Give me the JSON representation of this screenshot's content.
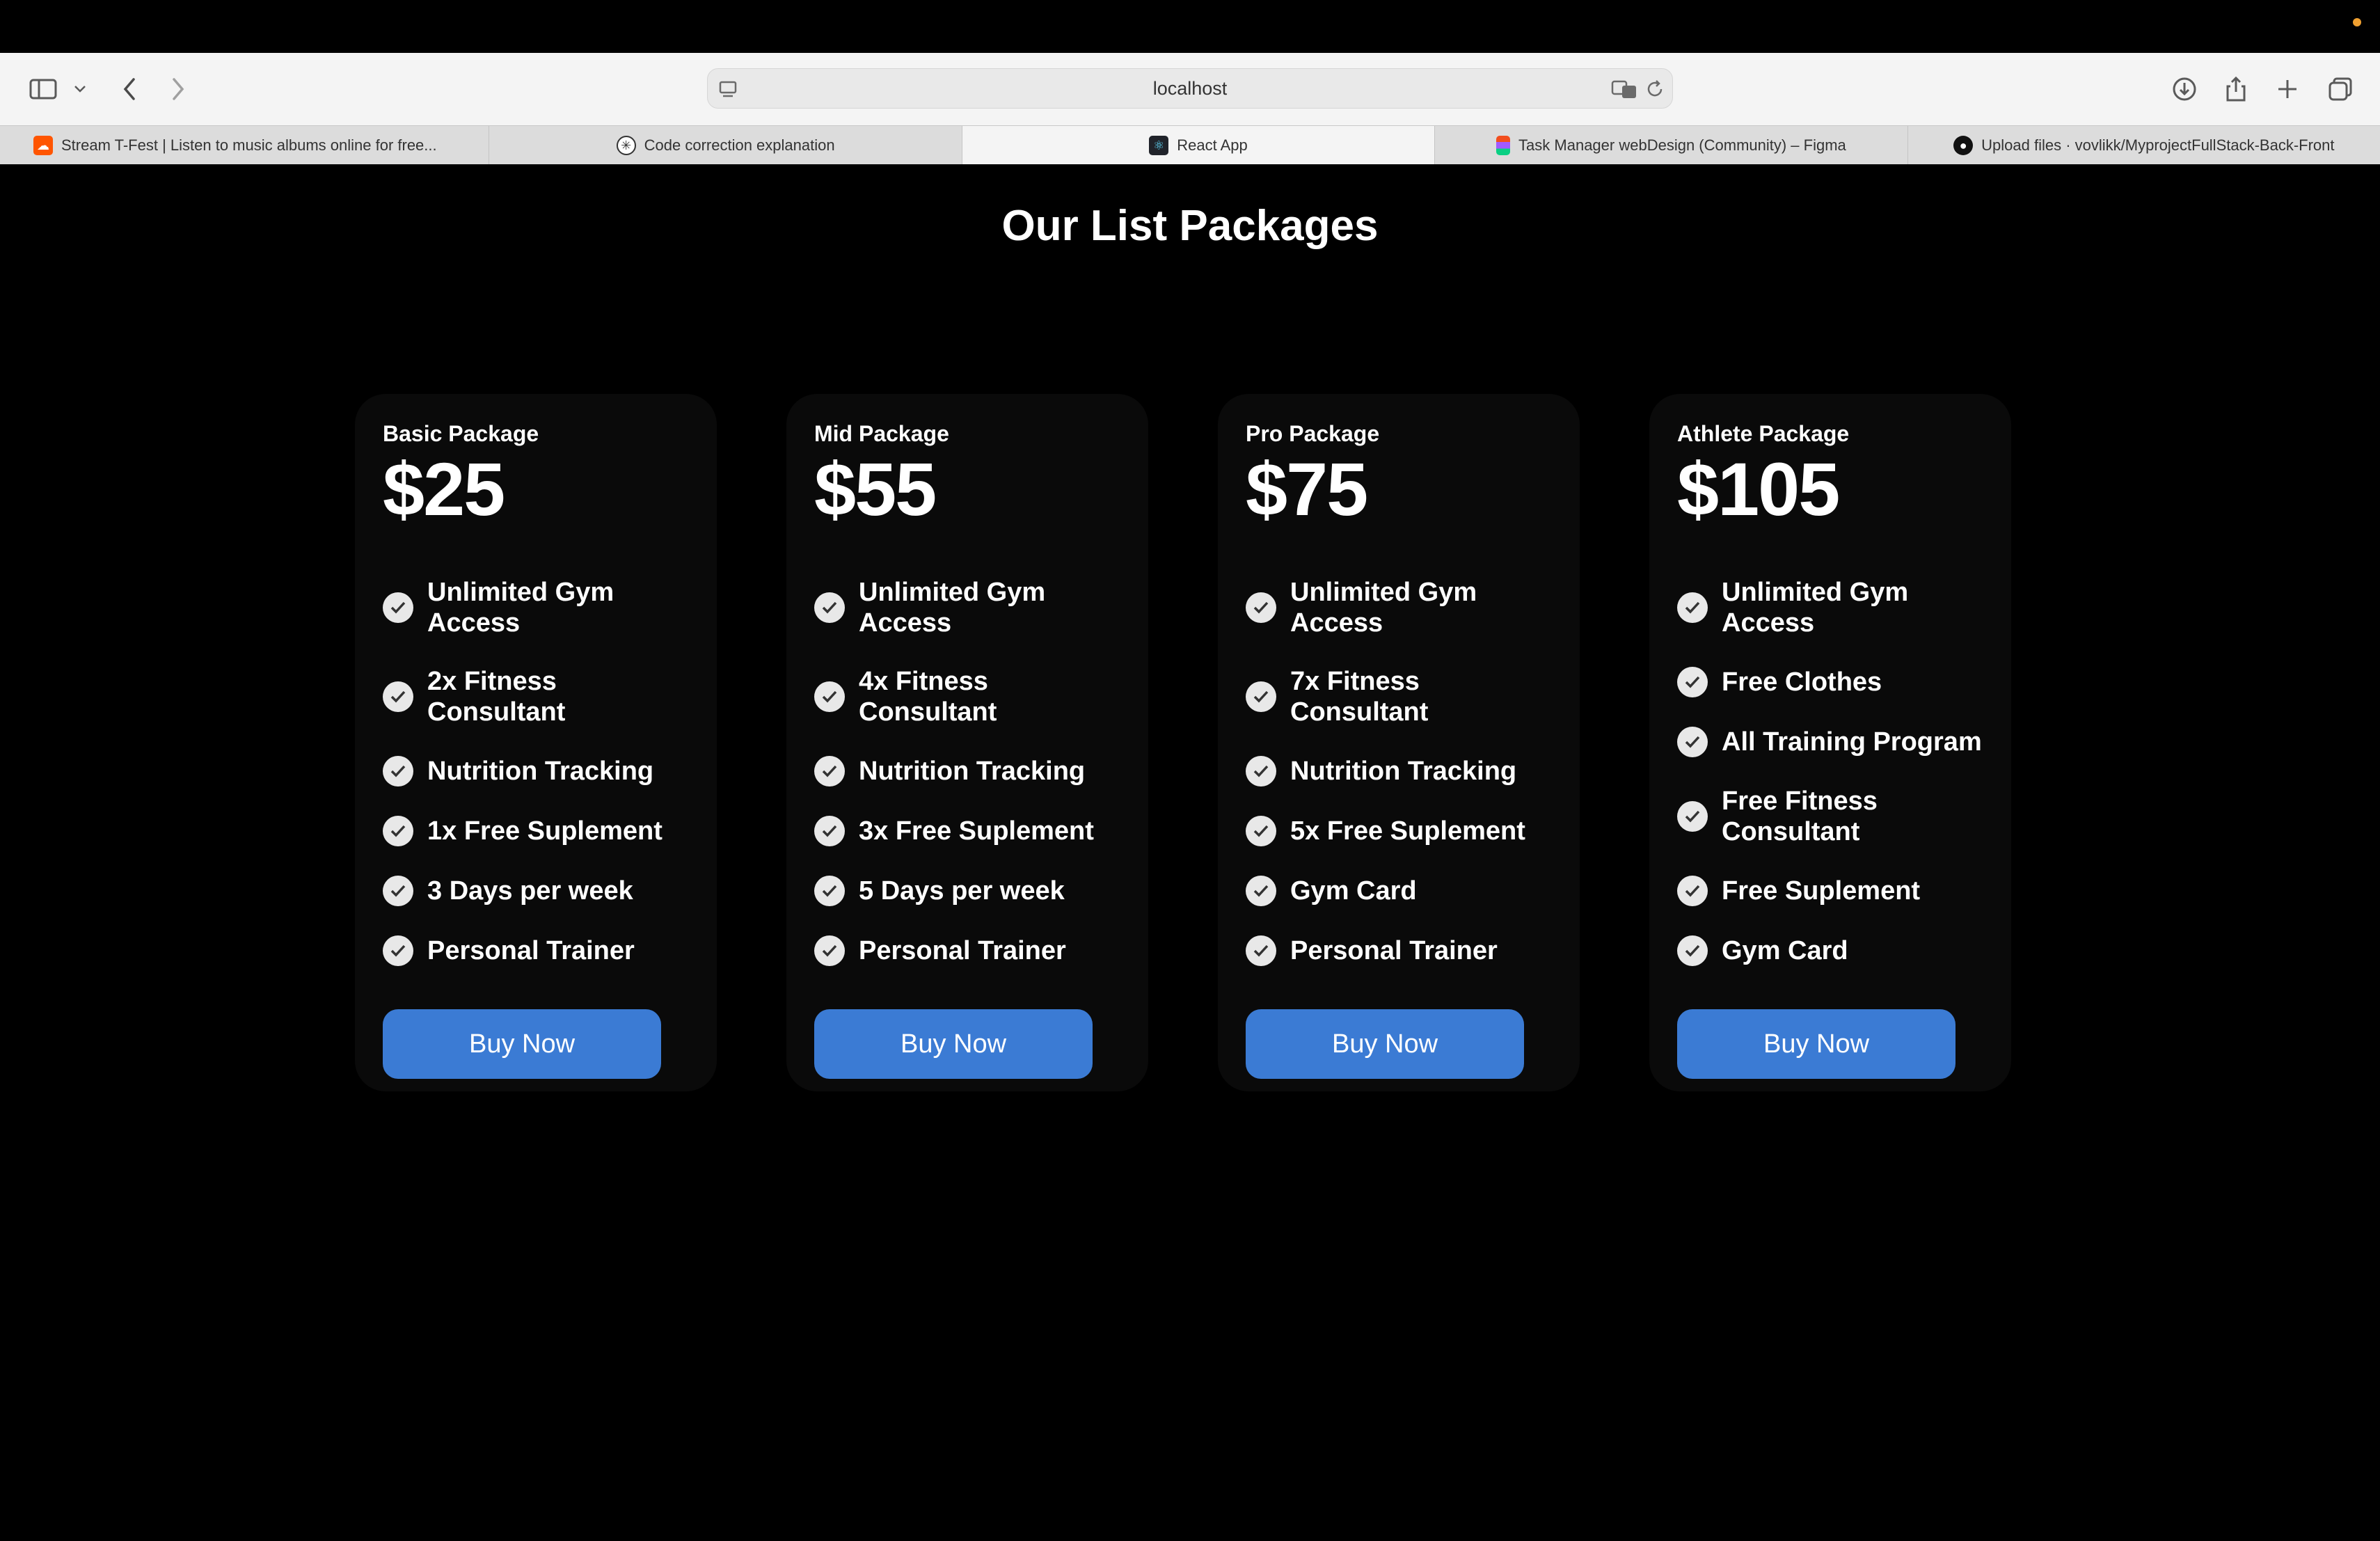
{
  "browser": {
    "address": "localhost",
    "tabs": [
      {
        "label": "Stream T-Fest | Listen to music albums online for free...",
        "favicon": "soundcloud-icon",
        "color": "#ff5500",
        "active": false
      },
      {
        "label": "Code correction explanation",
        "favicon": "chatgpt-icon",
        "color": "#333333",
        "active": false
      },
      {
        "label": "React App",
        "favicon": "react-icon",
        "color": "#20232a",
        "active": true
      },
      {
        "label": "Task Manager webDesign (Community) – Figma",
        "favicon": "figma-icon",
        "color": "#f24e1e",
        "active": false
      },
      {
        "label": "Upload files · vovlikk/MyprojectFullStack-Back-Front",
        "favicon": "github-icon",
        "color": "#111111",
        "active": false
      }
    ]
  },
  "page": {
    "title": "Our List Packages",
    "accent": "#3b7bd4",
    "packages": [
      {
        "name": "Basic Package",
        "price": "$25",
        "features": [
          "Unlimited Gym Access",
          "2x Fitness Consultant",
          "Nutrition Tracking",
          "1x Free Suplement",
          "3 Days per week",
          "Personal Trainer"
        ],
        "button": "Buy Now"
      },
      {
        "name": "Mid Package",
        "price": "$55",
        "features": [
          "Unlimited Gym Access",
          "4x Fitness Consultant",
          "Nutrition Tracking",
          "3x Free Suplement",
          "5 Days per week",
          "Personal Trainer"
        ],
        "button": "Buy Now"
      },
      {
        "name": "Pro Package",
        "price": "$75",
        "features": [
          "Unlimited Gym Access",
          "7x Fitness Consultant",
          "Nutrition Tracking",
          "5x Free Suplement",
          "Gym Card",
          "Personal Trainer"
        ],
        "button": "Buy Now"
      },
      {
        "name": "Athlete Package",
        "price": "$105",
        "features": [
          "Unlimited Gym Access",
          "Free Clothes",
          "All Training Program",
          "Free Fitness Consultant",
          "Free Suplement",
          "Gym Card"
        ],
        "button": "Buy Now"
      }
    ]
  }
}
